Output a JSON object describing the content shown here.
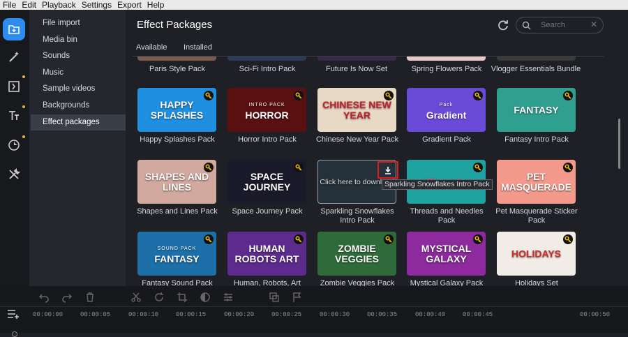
{
  "menu": [
    "File",
    "Edit",
    "Playback",
    "Settings",
    "Export",
    "Help"
  ],
  "sidebar": {
    "items": [
      "File import",
      "Media bin",
      "Sounds",
      "Music",
      "Sample videos",
      "Backgrounds",
      "Effect packages"
    ],
    "selected": "Effect packages"
  },
  "main": {
    "title": "Effect Packages",
    "search_placeholder": "Search",
    "tabs": [
      "Available",
      "Installed"
    ]
  },
  "row0_captions": [
    "Paris Style Pack",
    "Sci-Fi Intro Pack",
    "Future Is Now Set",
    "Spring Flowers Pack",
    "Vlogger Essentials Bundle"
  ],
  "packs": [
    {
      "name": "Happy Splashes Pack",
      "art": "HAPPY SPLASHES",
      "bg": "#1f8fe0",
      "locked": true
    },
    {
      "name": "Horror Intro Pack",
      "art": "HORROR",
      "sub": "INTRO PACK",
      "bg": "#5a1010",
      "locked": true
    },
    {
      "name": "Chinese New Year Pack",
      "art": "CHINESE NEW YEAR",
      "bg": "#e8d9c4",
      "art_color": "#c0202a",
      "locked": true
    },
    {
      "name": "Gradient Pack",
      "art": "Gradient",
      "sub": "Pack",
      "bg": "#6a4bd8",
      "locked": true
    },
    {
      "name": "Fantasy Intro Pack",
      "art": "FANTASY",
      "bg": "#2fa08f",
      "locked": true
    },
    {
      "name": "Shapes and Lines Pack",
      "art": "SHAPES AND LINES",
      "bg": "#d2a99e",
      "locked": true
    },
    {
      "name": "Space Journey Pack",
      "art": "SPACE JOURNEY",
      "bg": "#1a1a2a",
      "locked": true
    },
    {
      "name": "Sparkling Snowflakes Intro Pack",
      "art": "Click here to download",
      "bg": "#24303a",
      "locked": false,
      "hover": true
    },
    {
      "name": "Threads and Needles Pack",
      "art": "Threads",
      "bg": "#1fa3a0",
      "art_color": "#e94a8e",
      "locked": true
    },
    {
      "name": "Pet Masquerade Sticker Pack",
      "art": "PET MASQUERADE",
      "bg": "#f39a8c",
      "locked": true
    },
    {
      "name": "Fantasy Sound Pack",
      "art": "FANTASY",
      "sub": "SOUND PACK",
      "bg": "#1c6fa8",
      "locked": true
    },
    {
      "name": "Human, Robots, Art",
      "art": "HUMAN ROBOTS ART",
      "bg": "#5d2a8e",
      "locked": true
    },
    {
      "name": "Zombie Veggies Pack",
      "art": "ZOMBIE VEGGIES",
      "bg": "#2f6b3a",
      "locked": true
    },
    {
      "name": "Mystical Galaxy Pack",
      "art": "MYSTICAL GALAXY",
      "bg": "#8c2a9e",
      "locked": true
    },
    {
      "name": "Holidays Set",
      "art": "HOLIDAYS",
      "bg": "#f1ece6",
      "art_color": "#c8302a",
      "locked": true
    }
  ],
  "tooltip": "Sparkling Snowflakes Intro Pack",
  "timeline": {
    "ruler": [
      "00:00:00",
      "00:00:05",
      "00:00:10",
      "00:00:15",
      "00:00:20",
      "00:00:25",
      "00:00:30",
      "00:00:35",
      "00:00:40",
      "00:00:45",
      "00:00:50"
    ]
  },
  "colors": {
    "accent": "#2d8cf0",
    "highlight_box": "#e01b1b",
    "key_badge": "#f2c300"
  }
}
